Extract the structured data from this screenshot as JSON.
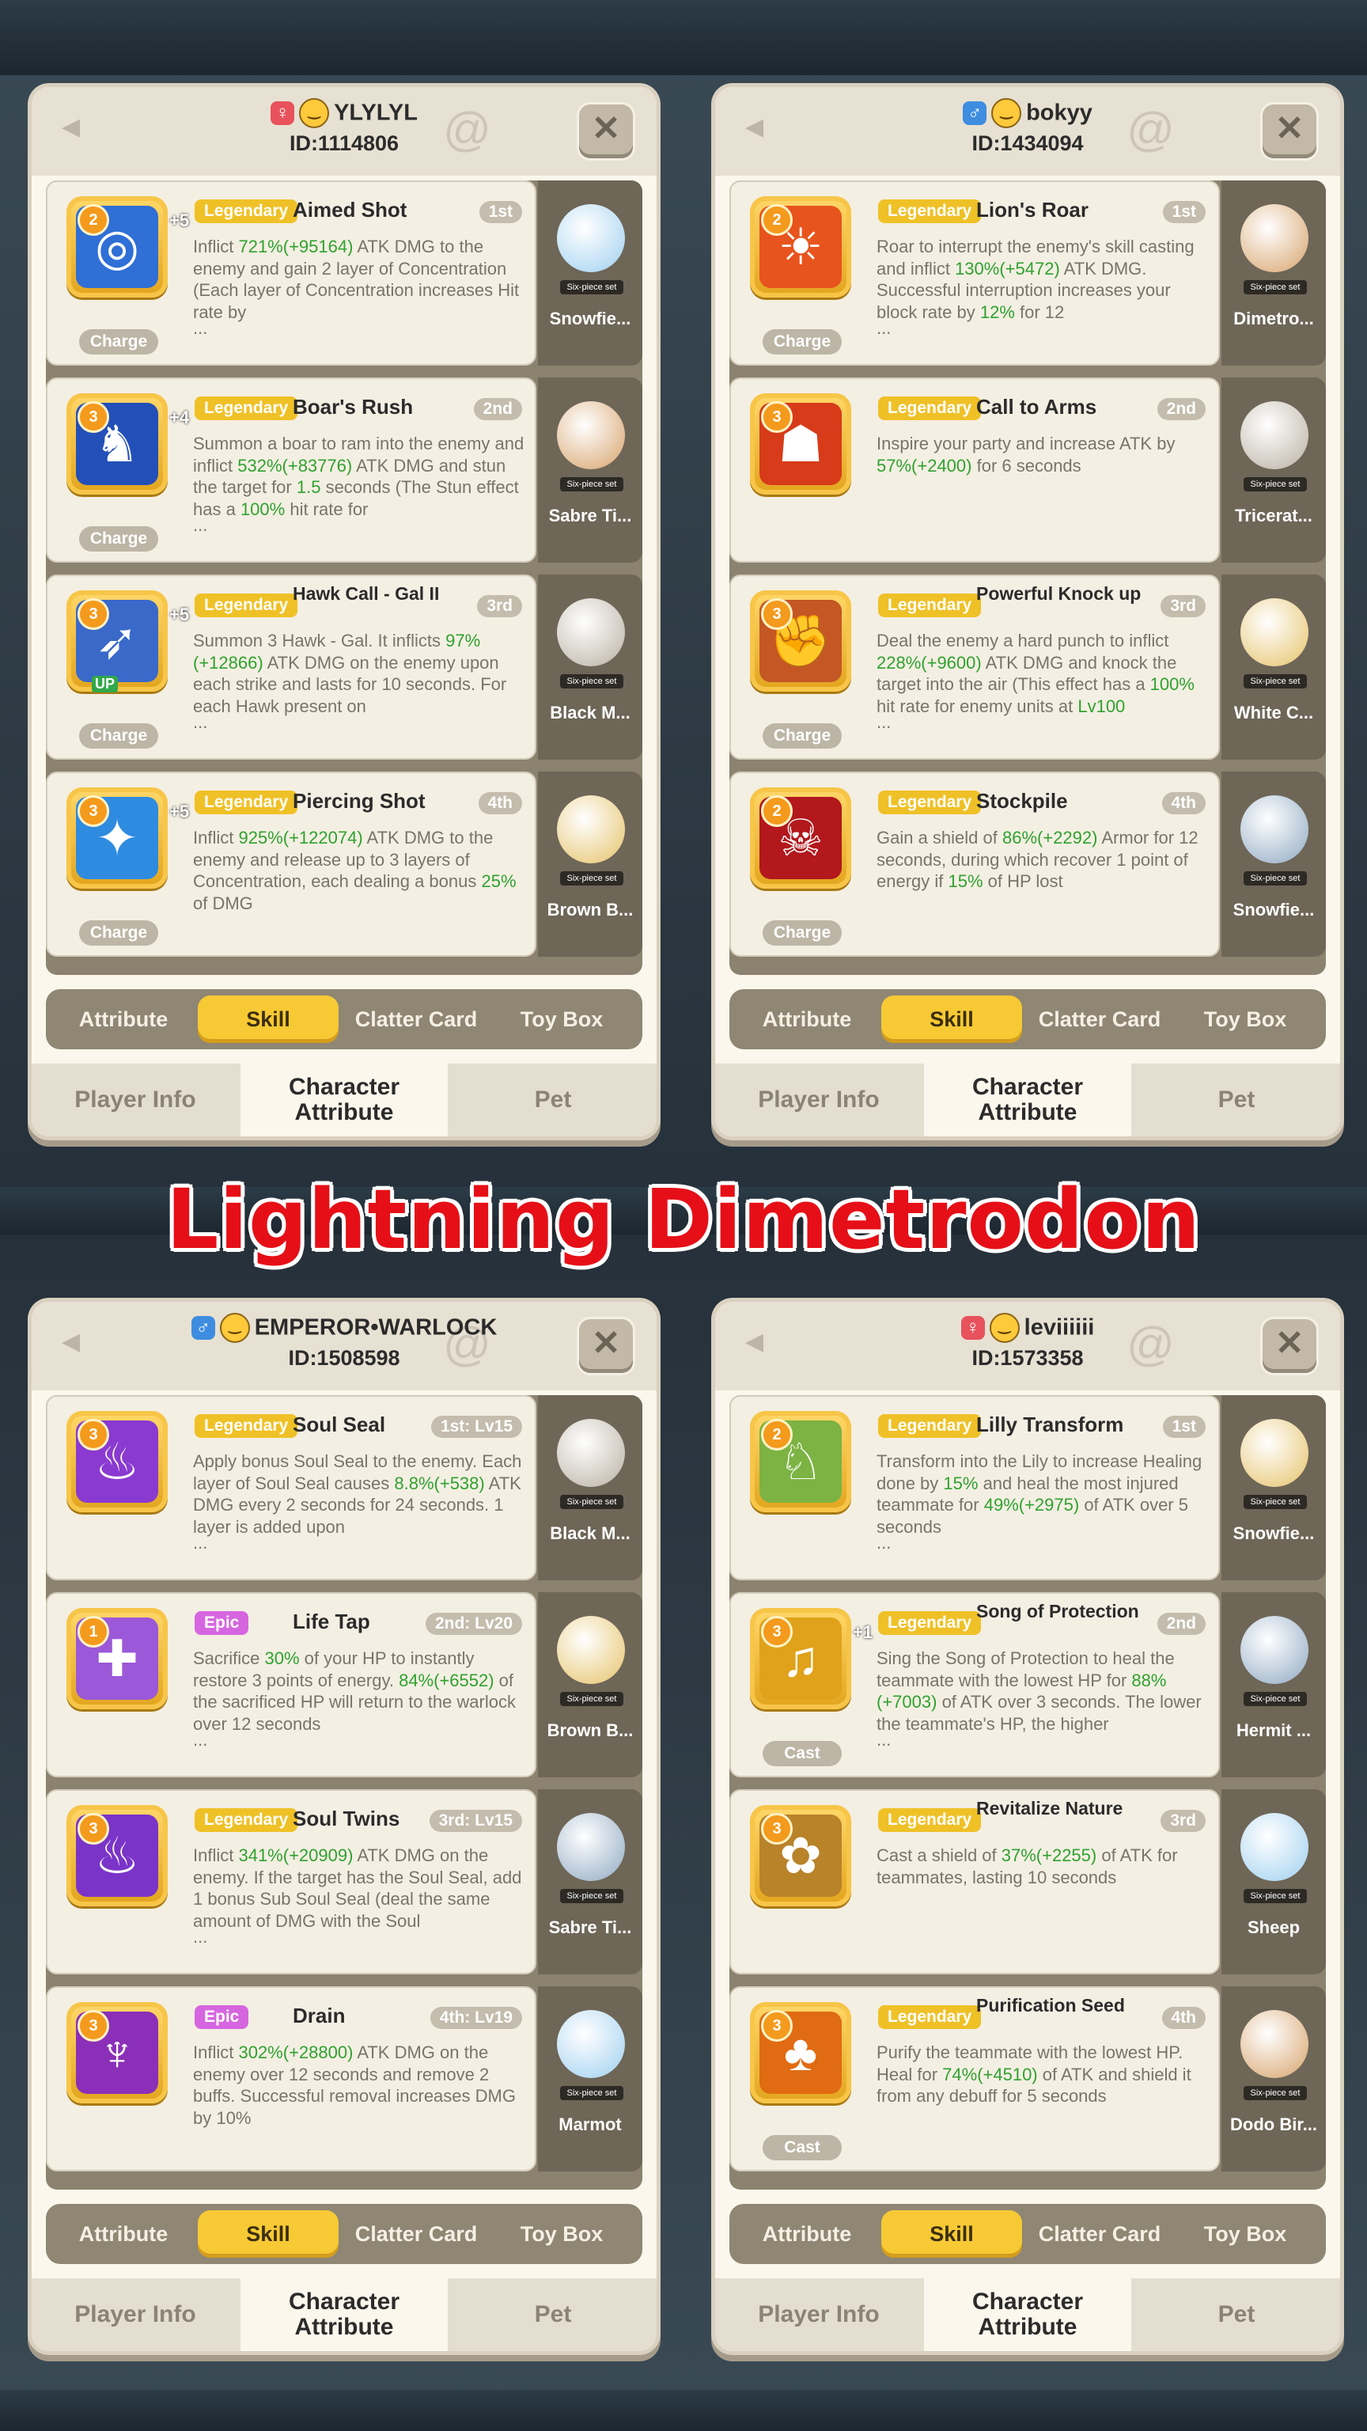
{
  "banner_title": "Lightning Dimetrodon",
  "panels": [
    {
      "player": {
        "gender": "female",
        "name": "YLYLYL",
        "id": "ID:1114806"
      },
      "tabs": {
        "attribute": "Attribute",
        "skill": "Skill",
        "clatter": "Clatter Card",
        "toybox": "Toy Box"
      },
      "nav": {
        "player_info": "Player Info",
        "character_attribute": "Character Attribute",
        "pet": "Pet"
      },
      "skills": [
        {
          "rank": "2",
          "rarity": "Legendary",
          "name": "Aimed Shot",
          "order": "1st",
          "pill": "Charge",
          "plus": "+5",
          "desc": "Inflict 721%(+95164) ATK DMG to the enemy and gain 2 layer of Concentration (Each layer of Concentration increases Hit rate by",
          "character": "Snowfie...",
          "six": "Six-piece set"
        },
        {
          "rank": "3",
          "rarity": "Legendary",
          "name": "Boar's Rush",
          "order": "2nd",
          "pill": "Charge",
          "plus": "+4",
          "desc": "Summon a boar to ram into the enemy and inflict 532%(+83776) ATK DMG and stun the target for 1.5 seconds (The Stun effect has a 100% hit rate for",
          "character": "Sabre Ti...",
          "six": "Six-piece set"
        },
        {
          "rank": "3",
          "rarity": "Legendary",
          "name": "Hawk Call - Gal II",
          "order": "3rd",
          "pill": "Charge",
          "plus": "+5",
          "up": "UP",
          "desc": "Summon 3 Hawk - Gal. It inflicts 97%(+12866) ATK DMG on the enemy upon each strike and lasts for 10 seconds. For each Hawk present on",
          "character": "Black M...",
          "six": "Six-piece set"
        },
        {
          "rank": "3",
          "rarity": "Legendary",
          "name": "Piercing Shot",
          "order": "4th",
          "pill": "Charge",
          "plus": "+5",
          "desc": "Inflict 925%(+122074) ATK DMG to the enemy and release up to 3 layers of Concentration, each dealing a bonus 25% of DMG",
          "character": "Brown B...",
          "six": "Six-piece set"
        }
      ]
    },
    {
      "player": {
        "gender": "male",
        "name": "bokyy",
        "id": "ID:1434094"
      },
      "tabs": {
        "attribute": "Attribute",
        "skill": "Skill",
        "clatter": "Clatter Card",
        "toybox": "Toy Box"
      },
      "nav": {
        "player_info": "Player Info",
        "character_attribute": "Character Attribute",
        "pet": "Pet"
      },
      "skills": [
        {
          "rank": "2",
          "rarity": "Legendary",
          "name": "Lion's Roar",
          "order": "1st",
          "pill": "Charge",
          "desc": "Roar to interrupt the enemy's skill casting and inflict 130%(+5472) ATK DMG. Successful interruption increases your block rate by 12% for 12",
          "character": "Dimetro...",
          "six": "Six-piece set"
        },
        {
          "rank": "3",
          "rarity": "Legendary",
          "name": "Call to Arms",
          "order": "2nd",
          "desc": "Inspire your party and increase ATK by 57%(+2400) for 6 seconds",
          "character": "Tricerat...",
          "six": "Six-piece set"
        },
        {
          "rank": "3",
          "rarity": "Legendary",
          "name": "Powerful Knock up",
          "order": "3rd",
          "pill": "Charge",
          "desc": "Deal the enemy a hard punch to inflict 228%(+9600) ATK DMG and knock the target into the air (This effect has a 100% hit rate for enemy units at Lv100",
          "character": "White C...",
          "six": "Six-piece set"
        },
        {
          "rank": "2",
          "rarity": "Legendary",
          "name": "Stockpile",
          "order": "4th",
          "pill": "Charge",
          "desc": "Gain a shield of 86%(+2292) Armor for 12 seconds, during which recover 1 point of energy if 15% of HP lost",
          "character": "Snowfie...",
          "six": "Six-piece set"
        }
      ]
    },
    {
      "player": {
        "gender": "male",
        "name": "EMPEROR•WARLOCK",
        "id": "ID:1508598"
      },
      "tabs": {
        "attribute": "Attribute",
        "skill": "Skill",
        "clatter": "Clatter Card",
        "toybox": "Toy Box"
      },
      "nav": {
        "player_info": "Player Info",
        "character_attribute": "Character Attribute",
        "pet": "Pet"
      },
      "skills": [
        {
          "rank": "3",
          "rarity": "Legendary",
          "name": "Soul Seal",
          "order": "1st: Lv15",
          "desc": "Apply bonus Soul Seal to the enemy. Each layer of Soul Seal causes 8.8%(+538) ATK DMG every 2 seconds for 24 seconds. 1 layer is added upon",
          "character": "Black M...",
          "six": "Six-piece set"
        },
        {
          "rank": "1",
          "rarity": "Epic",
          "name": "Life Tap",
          "order": "2nd: Lv20",
          "desc": "Sacrifice 30% of your HP to instantly restore 3 points of energy. 84%(+6552) of the sacrificed HP will return to the warlock over 12 seconds",
          "character": "Brown B...",
          "six": "Six-piece set"
        },
        {
          "rank": "3",
          "rarity": "Legendary",
          "name": "Soul Twins",
          "order": "3rd: Lv15",
          "desc": "Inflict 341%(+20909) ATK DMG on the enemy. If the target has the Soul Seal, add 1 bonus Sub Soul Seal (deal the same amount of DMG with the Soul",
          "character": "Sabre Ti...",
          "six": "Six-piece set"
        },
        {
          "rank": "3",
          "rarity": "Epic",
          "name": "Drain",
          "order": "4th: Lv19",
          "desc": "Inflict 302%(+28800) ATK DMG on the enemy over 12 seconds and remove 2 buffs. Successful removal increases DMG by 10%",
          "character": "Marmot",
          "six": "Six-piece set"
        }
      ]
    },
    {
      "player": {
        "gender": "female",
        "name": "leviiiiii",
        "id": "ID:1573358"
      },
      "tabs": {
        "attribute": "Attribute",
        "skill": "Skill",
        "clatter": "Clatter Card",
        "toybox": "Toy Box"
      },
      "nav": {
        "player_info": "Player Info",
        "character_attribute": "Character Attribute",
        "pet": "Pet"
      },
      "skills": [
        {
          "rank": "2",
          "rarity": "Legendary",
          "name": "Lilly Transform",
          "order": "1st",
          "desc": "Transform into the Lily to increase Healing done by 15% and heal the most injured teammate for 49%(+2975) of ATK over 5 seconds",
          "character": "Snowfie...",
          "six": "Six-piece set"
        },
        {
          "rank": "3",
          "rarity": "Legendary",
          "name": "Song of Protection",
          "order": "2nd",
          "pill": "Cast",
          "plus": "+1",
          "desc": "Sing the Song of Protection to heal the teammate with the lowest HP for 88%(+7003) of ATK over 3 seconds. The lower the teammate's HP, the higher",
          "character": "Hermit ...",
          "six": "Six-piece set"
        },
        {
          "rank": "3",
          "rarity": "Legendary",
          "name": "Revitalize Nature",
          "order": "3rd",
          "desc": "Cast a shield of 37%(+2255) of ATK for teammates, lasting 10 seconds",
          "character": "Sheep",
          "six": "Six-piece set"
        },
        {
          "rank": "3",
          "rarity": "Legendary",
          "name": "Purification Seed",
          "order": "4th",
          "pill": "Cast",
          "desc": "Purify the teammate with the lowest HP. Heal for 74%(+4510) of ATK and shield it from any debuff for 5 seconds",
          "character": "Dodo Bir...",
          "six": "Six-piece set"
        }
      ]
    }
  ],
  "icon_themes": [
    [
      "crosshair-icon",
      "boar-icon",
      "hawk-icon",
      "arrow-burst-icon"
    ],
    [
      "lion-icon",
      "warrior-icon",
      "fist-icon",
      "shield-skull-icon"
    ],
    [
      "soul-flame-icon",
      "life-tap-icon",
      "twin-flame-icon",
      "drain-icon"
    ],
    [
      "owl-icon",
      "song-shield-icon",
      "nature-icon",
      "seed-flame-icon"
    ]
  ],
  "colors": {
    "legendary": "#efc127",
    "epic": "#d666e0",
    "highlight": "#2fa22f",
    "banner": "#e60f17"
  }
}
